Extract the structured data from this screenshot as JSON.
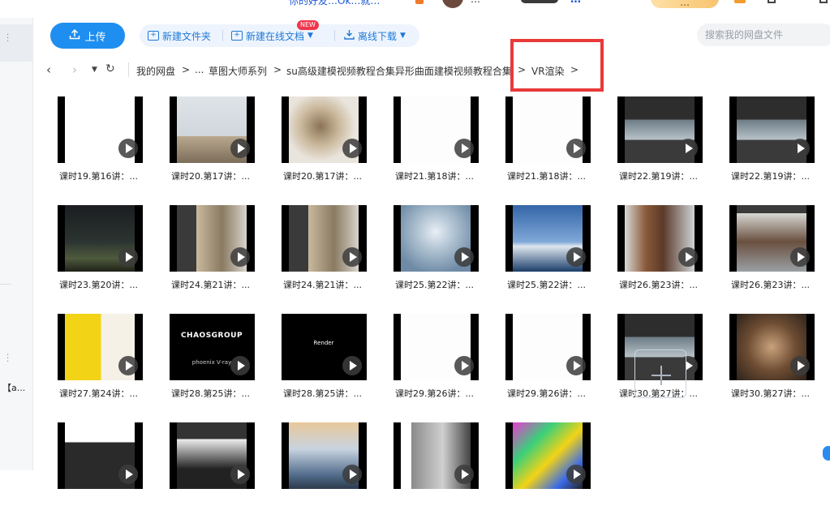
{
  "top_strip": {
    "notice": "你的好友…Ok…就…",
    "username": "…",
    "link": "…",
    "vip": "…"
  },
  "toolbar": {
    "upload_label": "上传",
    "new_folder_label": "新建文件夹",
    "new_online_doc_label": "新建在线文档",
    "new_badge": "NEW",
    "offline_download_label": "离线下载",
    "search_placeholder": "搜索我的网盘文件"
  },
  "breadcrumb": {
    "items": [
      "我的网盘",
      "...",
      "草图大师系列",
      "su高级建模视频教程合集异形曲面建模视频教程合集",
      "VR渲染"
    ],
    "separator": ">"
  },
  "sidebar": {
    "truncated_label": "【a..."
  },
  "files": [
    {
      "name": "课时19.第16讲：...",
      "theme": "ui"
    },
    {
      "name": "课时20.第17讲：...",
      "theme": "building-sky"
    },
    {
      "name": "课时20.第17讲：...",
      "theme": "plan-render"
    },
    {
      "name": "课时21.第18讲：...",
      "theme": "blank"
    },
    {
      "name": "课时21.第18讲：...",
      "theme": "blank"
    },
    {
      "name": "课时22.第19讲：...",
      "theme": "dark-ui"
    },
    {
      "name": "课时22.第19讲：...",
      "theme": "dark-ui"
    },
    {
      "name": "课时23.第20讲：...",
      "theme": "night"
    },
    {
      "name": "课时24.第21讲：...",
      "theme": "frame"
    },
    {
      "name": "课时24.第21讲：...",
      "theme": "frame"
    },
    {
      "name": "课时25.第22讲：...",
      "theme": "blue-curve"
    },
    {
      "name": "课时25.第22讲：...",
      "theme": "blue-sky"
    },
    {
      "name": "课时26.第23讲：...",
      "theme": "house"
    },
    {
      "name": "课时26.第23讲：...",
      "theme": "house-ui"
    },
    {
      "name": "课时27.第24讲：...",
      "theme": "yellow"
    },
    {
      "name": "课时28.第25讲：...",
      "theme": "chaos",
      "text": "CHAOSGROUP",
      "sub": "phoenix  V-ray"
    },
    {
      "name": "课时28.第25讲：...",
      "theme": "black",
      "text": "Render"
    },
    {
      "name": "课时29.第26讲：...",
      "theme": "blank"
    },
    {
      "name": "课时29.第26讲：...",
      "theme": "blank"
    },
    {
      "name": "课时30.第27讲：...",
      "theme": "dark-ui"
    },
    {
      "name": "课时30.第27讲：...",
      "theme": "pano"
    },
    {
      "name": "",
      "theme": "ui2"
    },
    {
      "name": "",
      "theme": "ui3"
    },
    {
      "name": "",
      "theme": "tower"
    },
    {
      "name": "",
      "theme": "grey-ui"
    },
    {
      "name": "",
      "theme": "pixel"
    }
  ],
  "colors": {
    "accent": "#1e8ef0",
    "highlight_box": "#e83a3a"
  }
}
